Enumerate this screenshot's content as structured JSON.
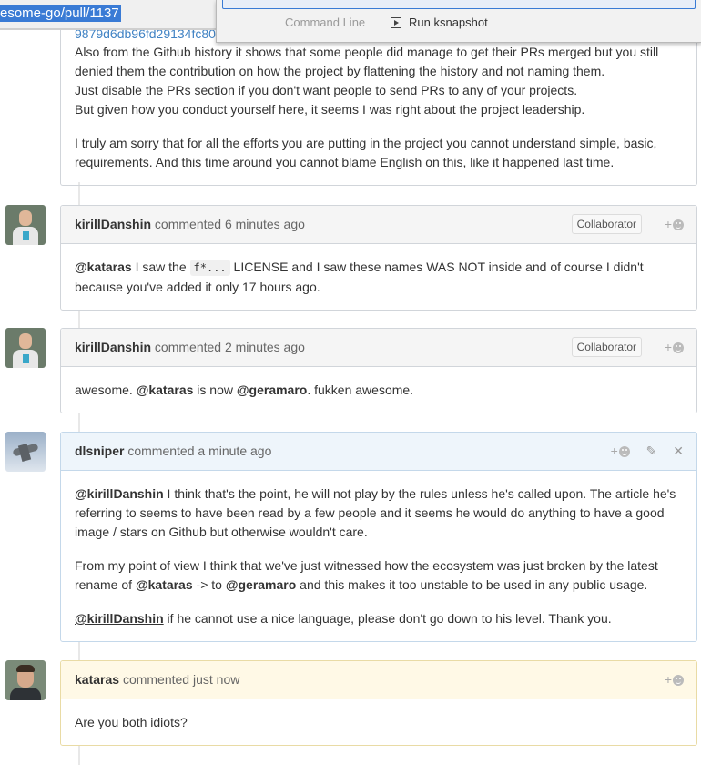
{
  "browser": {
    "url": "esome-go/pull/1137",
    "popup": {
      "section_label": "Command Line",
      "run_label": "Run ksnapshot"
    }
  },
  "top_comment": {
    "hash_link": "9879d6db96fd29134fc80",
    "lines": [
      "Also from the Github history it shows that some people did manage to get their PRs merged but you still denied them the contribution on how the project by flattening the history and not naming them.",
      "Just disable the PRs section if you don't want people to send PRs to any of your projects.",
      "But given how you conduct yourself here, it seems I was right about the project leadership."
    ],
    "paragraph2": "I truly am sorry that for all the efforts you are putting in the project you cannot understand simple, basic, requirements. And this time around you cannot blame English on this, like it happened last time."
  },
  "comments": [
    {
      "author": "kirillDanshin",
      "action": "commented",
      "time": "6 minutes ago",
      "badge": "Collaborator",
      "reaction": "+",
      "body": {
        "mention": "@kataras",
        "t1": " I saw the ",
        "code": "f*...",
        "t2": " LICENSE and I saw these names WAS NOT inside and of course I didn't because you've added it only 17 hours ago."
      }
    },
    {
      "author": "kirillDanshin",
      "action": "commented",
      "time": "2 minutes ago",
      "badge": "Collaborator",
      "reaction": "+",
      "body": {
        "t0": "awesome. ",
        "mention1": "@kataras",
        "t1": " is now ",
        "mention2": "@geramaro",
        "t2": ". fukken awesome."
      }
    },
    {
      "author": "dlsniper",
      "action": "commented",
      "time": "a minute ago",
      "reaction": "+",
      "body": {
        "p1_mention": "@kirillDanshin",
        "p1_text": " I think that's the point, he will not play by the rules unless he's called upon. The article he's referring to seems to have been read by a few people and it seems he would do anything to have a good image / stars on Github but otherwise wouldn't care.",
        "p2_t1": "From my point of view I think that we've just witnessed how the ecosystem was just broken by the latest rename of ",
        "p2_m1": "@kataras",
        "p2_t2": " -> to ",
        "p2_m2": "@geramaro",
        "p2_t3": " and this makes it too unstable to be used in any public usage.",
        "p3_mention": "@kirillDanshin",
        "p3_text": " if he cannot use a nice language, please don't go down to his level. Thank you."
      }
    },
    {
      "author": "kataras",
      "action": "commented",
      "time": "just now",
      "reaction": "+",
      "body": {
        "text": "Are you both idiots?"
      }
    }
  ],
  "icons": {
    "reaction": "smiley-icon",
    "edit": "pencil-icon",
    "delete": "close-icon",
    "run": "play-icon"
  }
}
